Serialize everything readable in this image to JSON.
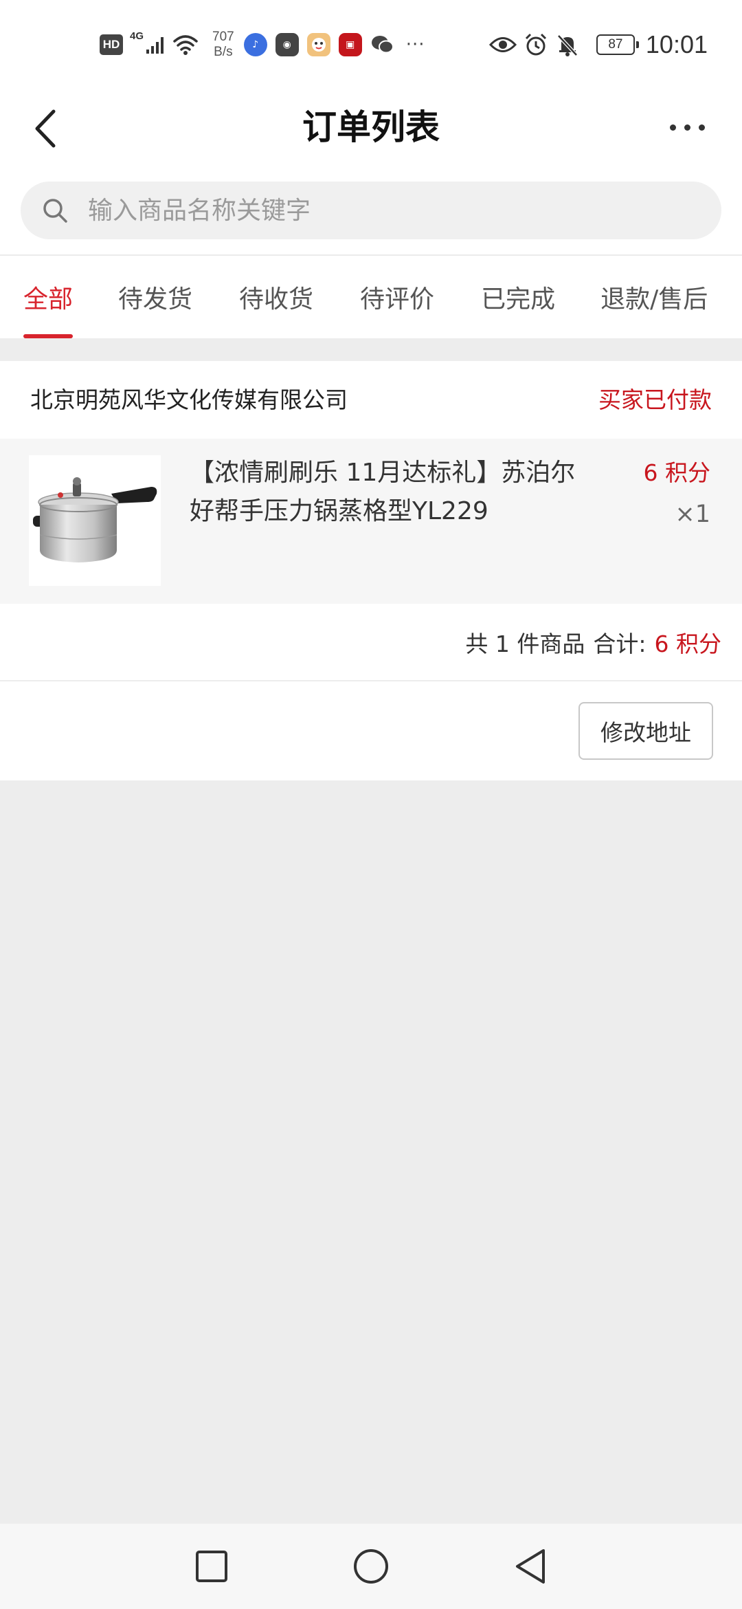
{
  "status_bar": {
    "network_badge": "HD",
    "network_gen": "4G",
    "speed_value": "707",
    "speed_unit": "B/s",
    "battery": "87",
    "time": "10:01",
    "more_notifications": "···"
  },
  "header": {
    "title": "订单列表"
  },
  "search": {
    "placeholder": "输入商品名称关键字"
  },
  "tabs": [
    {
      "label": "全部",
      "active": true
    },
    {
      "label": "待发货",
      "active": false
    },
    {
      "label": "待收货",
      "active": false
    },
    {
      "label": "待评价",
      "active": false
    },
    {
      "label": "已完成",
      "active": false
    },
    {
      "label": "退款/售后",
      "active": false
    }
  ],
  "order": {
    "shop_name": "北京明苑风华文化传媒有限公司",
    "status": "买家已付款",
    "goods": {
      "name": "【浓情刷刷乐 11月达标礼】苏泊尔好帮手压力锅蒸格型YL229",
      "price": "6 积分",
      "quantity": "×1"
    },
    "summary_count": "共 1 件商品",
    "summary_total_label": "合计:",
    "summary_total_value": "6 积分",
    "edit_address_label": "修改地址"
  },
  "colors": {
    "accent": "#d8242d",
    "price": "#c8161e",
    "background": "#ededed"
  }
}
